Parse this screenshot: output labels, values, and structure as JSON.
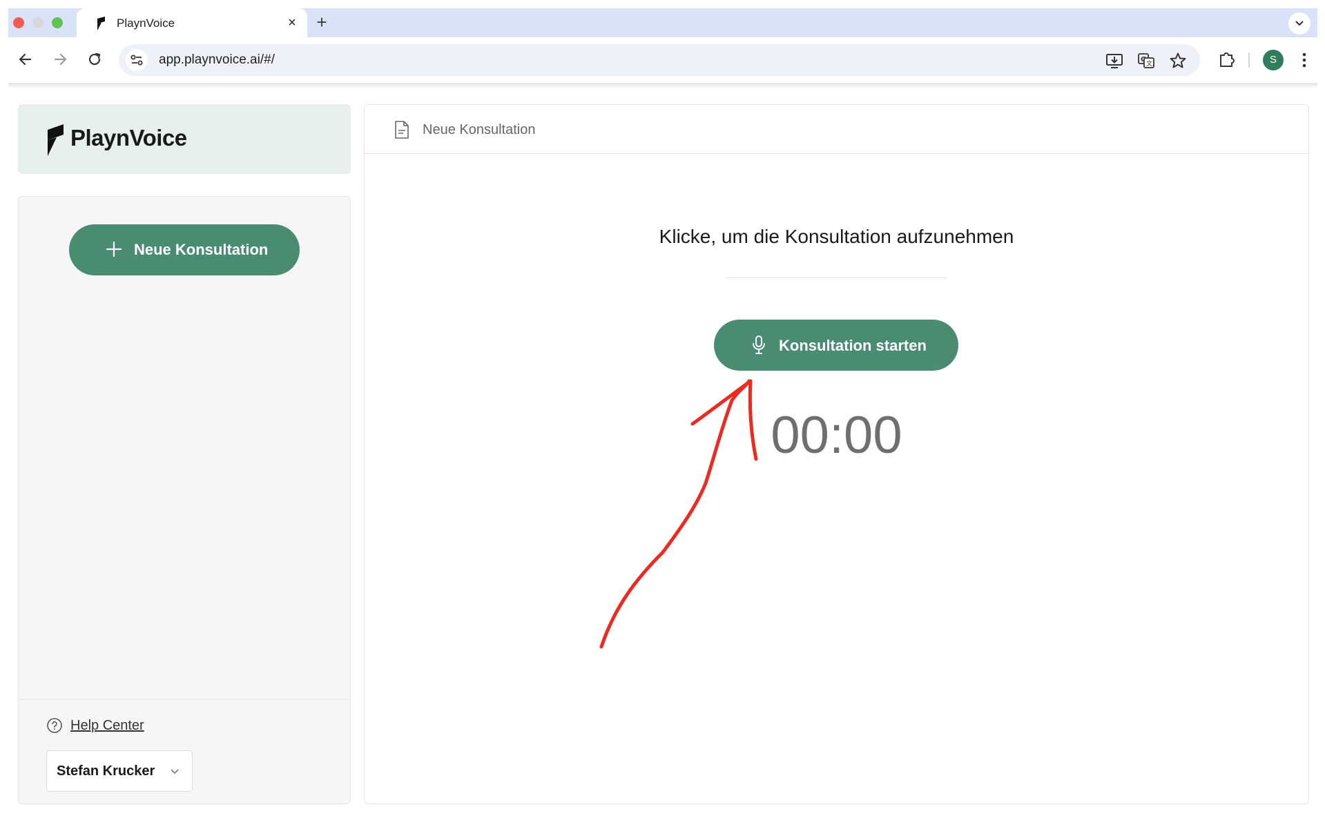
{
  "browser": {
    "tab_title": "PlaynVoice",
    "tab_close": "×",
    "new_tab": "+",
    "url": "app.playnvoice.ai/#/",
    "profile_initial": "S"
  },
  "app": {
    "logo_text": "PlaynVoice",
    "sidebar": {
      "new_consultation_label": "Neue Konsultation",
      "help_center_label": "Help Center",
      "user_name": "Stefan Krucker"
    },
    "main": {
      "title": "Neue Konsultation",
      "prompt": "Klicke, um die Konsultation aufzunehmen",
      "start_button_label": "Konsultation starten",
      "timer": "00:00"
    },
    "colors": {
      "accent": "#4a8c72",
      "logo_card_bg": "#e7f0ec",
      "sidebar_bg": "#f6f6f6",
      "annotation": "#ec2a22"
    }
  }
}
